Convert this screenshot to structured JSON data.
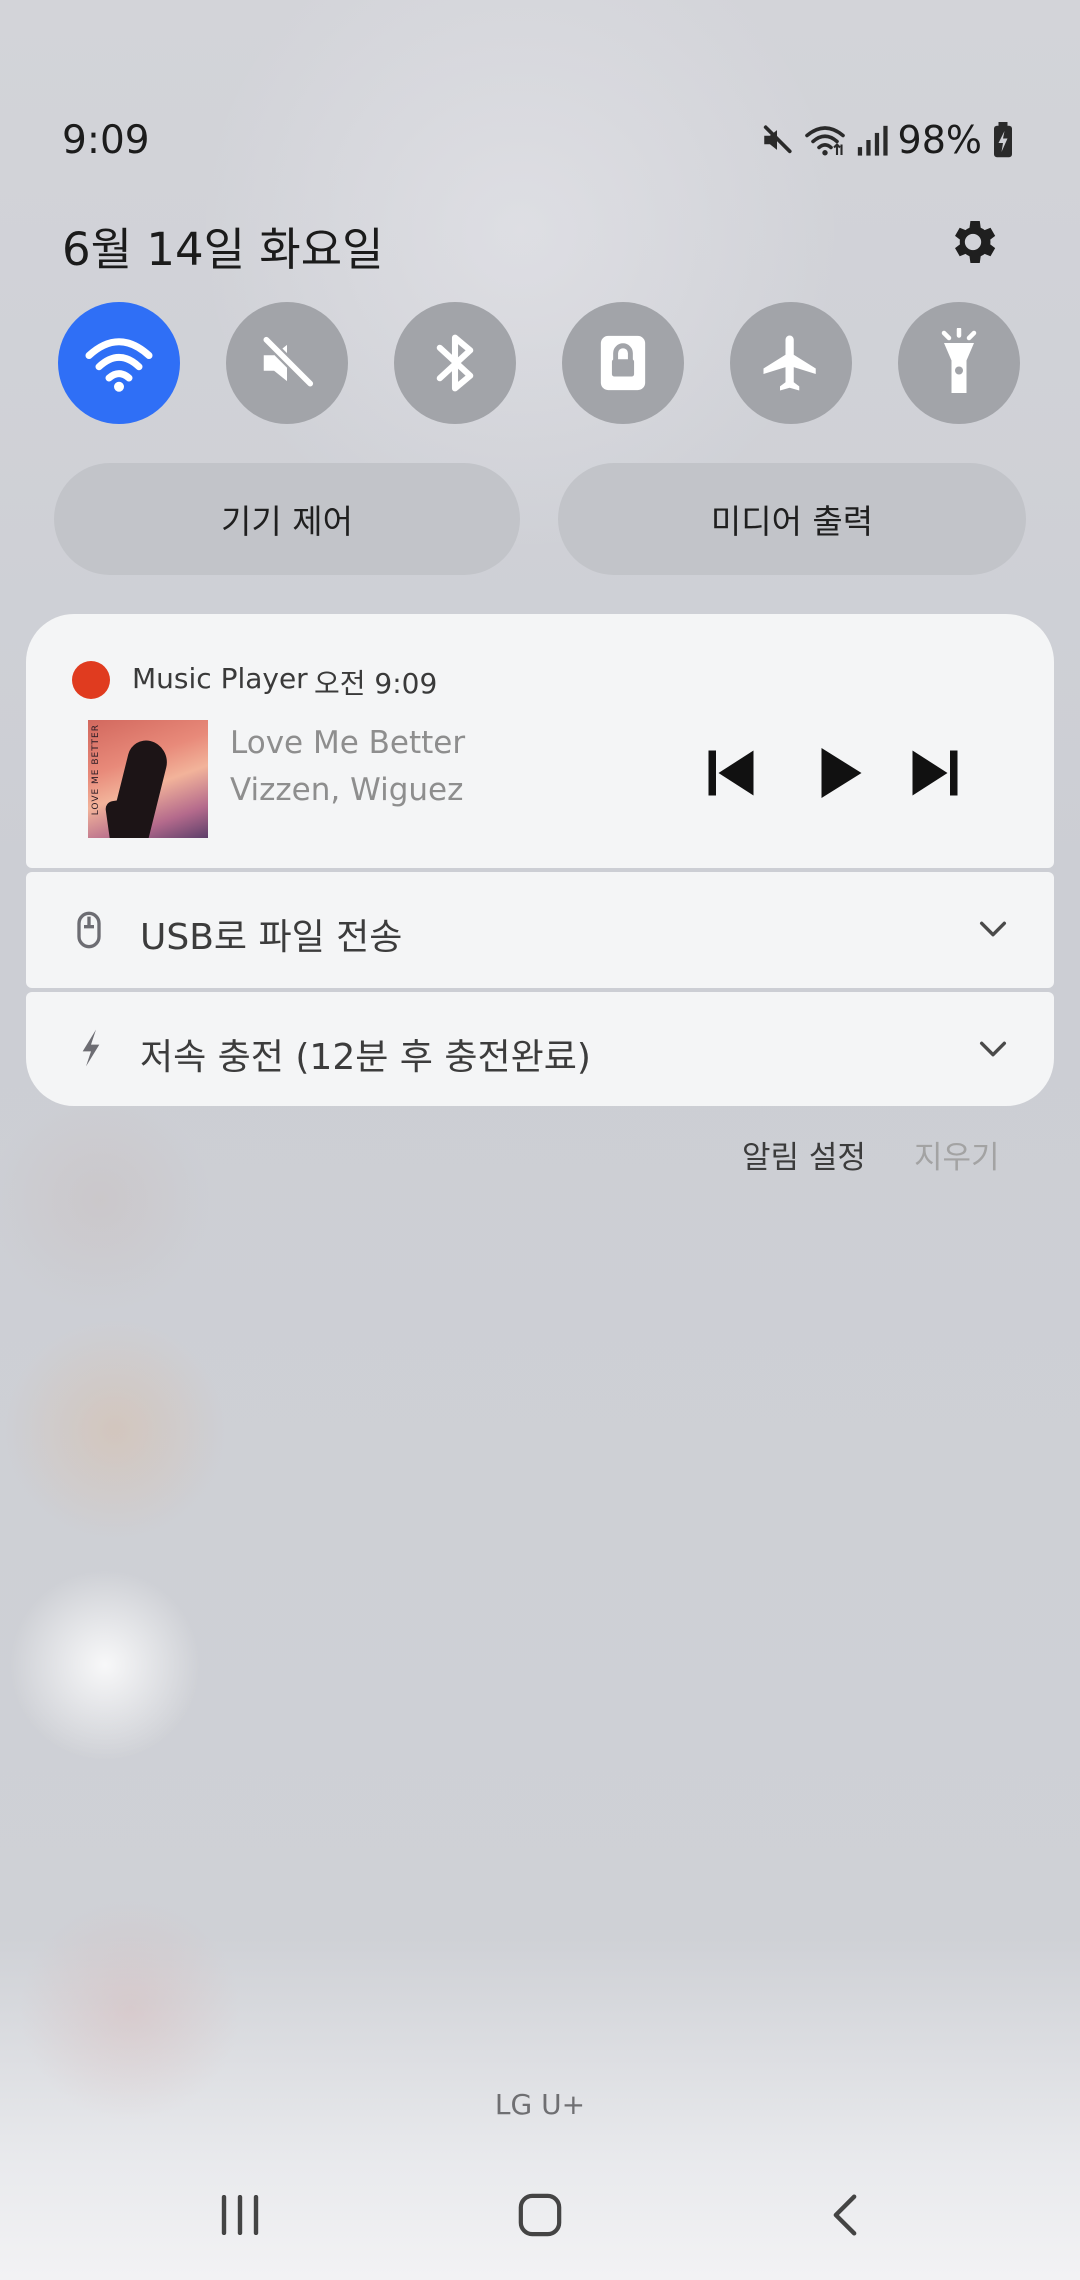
{
  "status_bar": {
    "time": "9:09",
    "battery": "98%"
  },
  "header": {
    "date": "6월 14일 화요일"
  },
  "quick_settings": {
    "toggles": [
      {
        "name": "wifi",
        "icon": "wifi-icon",
        "active": true
      },
      {
        "name": "sound",
        "icon": "mute-icon",
        "active": false
      },
      {
        "name": "bluetooth",
        "icon": "bluetooth-icon",
        "active": false
      },
      {
        "name": "rotation-lock",
        "icon": "lock-icon",
        "active": false
      },
      {
        "name": "airplane",
        "icon": "airplane-icon",
        "active": false
      },
      {
        "name": "flashlight",
        "icon": "flashlight-icon",
        "active": false
      }
    ],
    "device_control_label": "기기 제어",
    "media_output_label": "미디어 출력"
  },
  "media_notification": {
    "app_name": "Music Player",
    "time": "오전 9:09",
    "title": "Love Me Better",
    "artist": "Vizzen, Wiguez",
    "album_art_text": "LOVE ME BETTER"
  },
  "notifications": {
    "usb": {
      "label": "USB로 파일 전송"
    },
    "charging": {
      "label": "저속 충전 (12분 후 충전완료)"
    }
  },
  "footer": {
    "notification_settings_label": "알림 설정",
    "clear_label": "지우기",
    "carrier": "LG U+"
  },
  "colors": {
    "accent": "#2f6ff6",
    "toggle_off": "#a2a4a9",
    "app_dot": "#e03b1f",
    "card": "#f4f5f6"
  }
}
